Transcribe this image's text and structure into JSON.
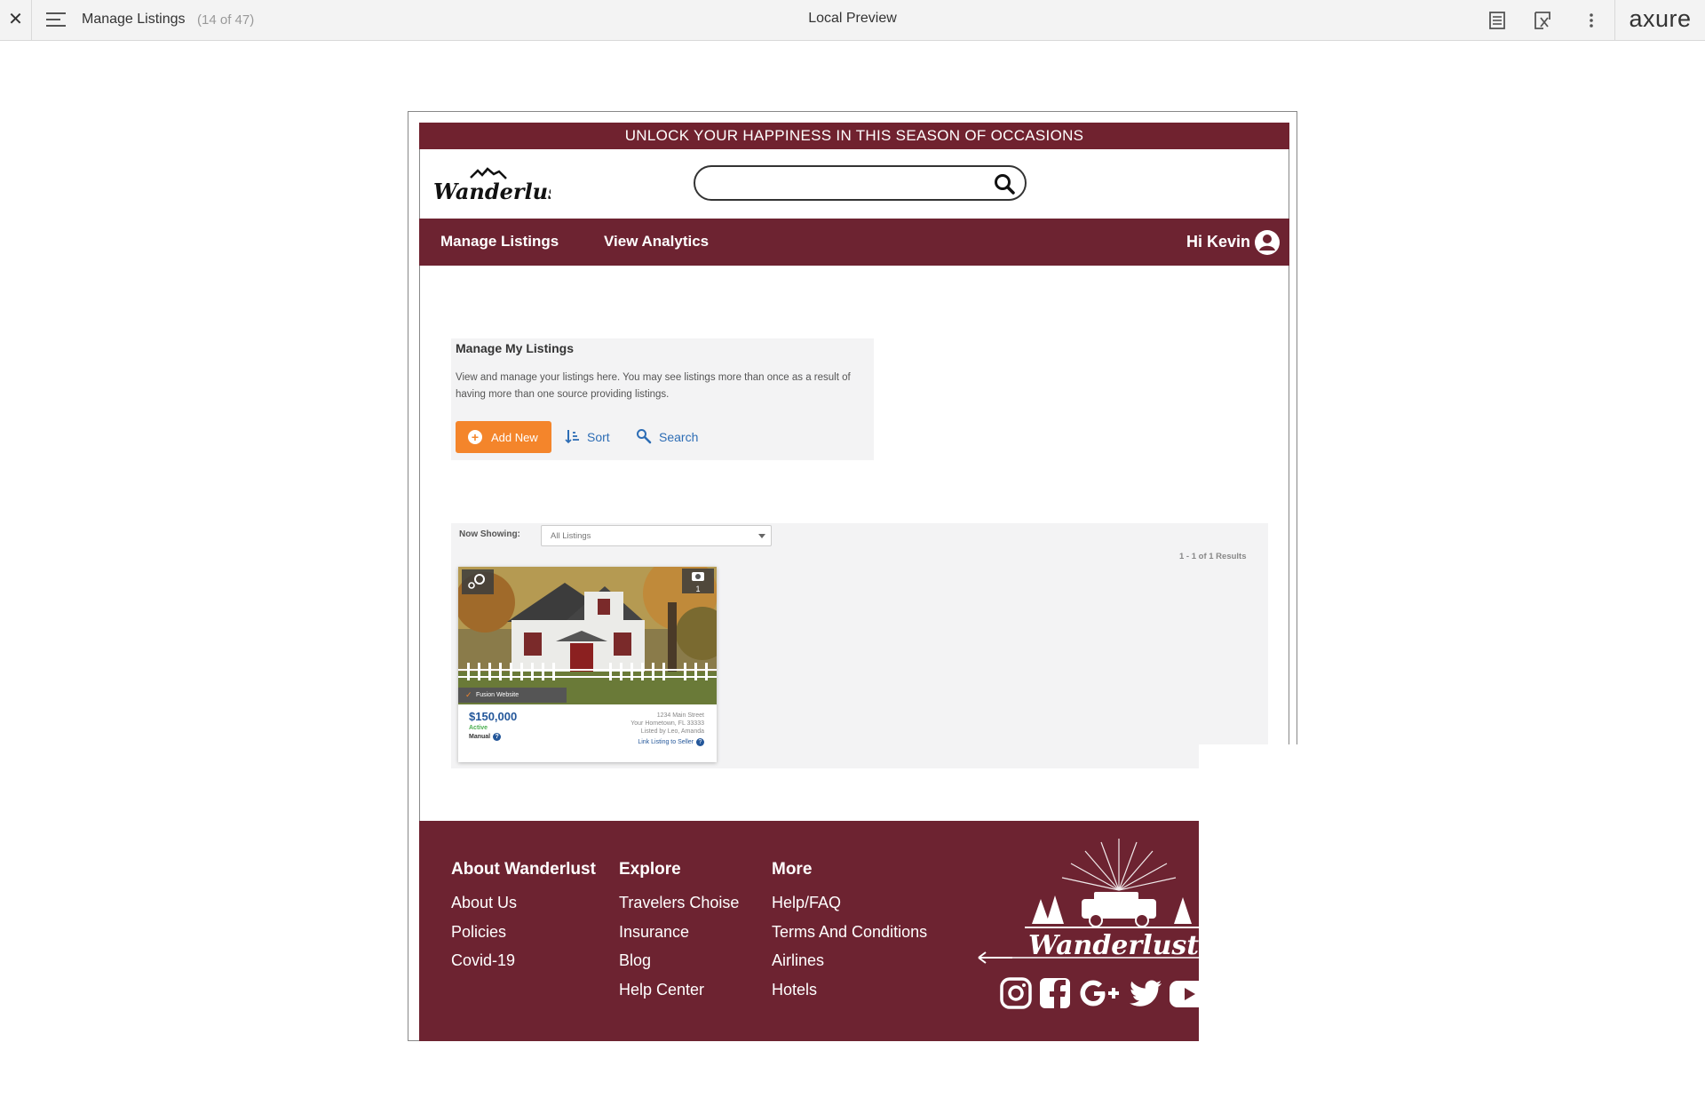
{
  "toolbar": {
    "close_icon": "close-icon",
    "menu_icon": "hamburger-menu-icon",
    "page_title": "Manage Listings",
    "page_count": "(14 of 47)",
    "center_label": "Local Preview",
    "notes_icon": "notes-icon",
    "inspect_icon": "inspect-icon",
    "more_icon": "more-vertical-icon",
    "brand": "axure"
  },
  "site": {
    "promo": "UNLOCK YOUR HAPPINESS IN THIS SEASON OF OCCASIONS",
    "logo_text": "Wanderlust",
    "search": {
      "value": "",
      "placeholder": ""
    },
    "nav": {
      "items": [
        {
          "label": "Manage Listings"
        },
        {
          "label": "View Analytics"
        }
      ],
      "greeting": "Hi Kevin"
    },
    "manage_panel": {
      "title": "Manage My Listings",
      "description": "View and manage your listings here. You may see listings more than once as a result of having more than one source providing listings.",
      "add_button": "Add New",
      "sort_button": "Sort",
      "search_button": "Search"
    },
    "listings_panel": {
      "now_showing_label": "Now Showing:",
      "filter_value": "All Listings",
      "results": "1 - 1 of 1 Results",
      "card": {
        "ribbon": "Fusion Website",
        "price": "$150,000",
        "status": "Active",
        "source": "Manual",
        "address_line1": "1234 Main Street",
        "address_line2": "Your Hometown, FL 33333",
        "listed_by": "Listed by Leo, Amanda",
        "link_label": "Link Listing to Seller",
        "photo_count": "1"
      }
    },
    "footer": {
      "columns": [
        {
          "heading": "About Wanderlust",
          "links": [
            "About Us",
            "Policies",
            "Covid-19"
          ]
        },
        {
          "heading": "Explore",
          "links": [
            "Travelers Choise",
            "Insurance",
            "Blog",
            "Help Center"
          ]
        },
        {
          "heading": "More",
          "links": [
            "Help/FAQ",
            "Terms And Conditions",
            "Airlines",
            "Hotels"
          ]
        }
      ],
      "logo_text": "Wanderlust",
      "social": [
        "instagram-icon",
        "facebook-icon",
        "google-plus-icon",
        "twitter-icon",
        "youtube-icon"
      ]
    }
  },
  "colors": {
    "brand_maroon": "#6d2331",
    "accent_orange": "#f4852b",
    "link_blue": "#2d6db5"
  }
}
